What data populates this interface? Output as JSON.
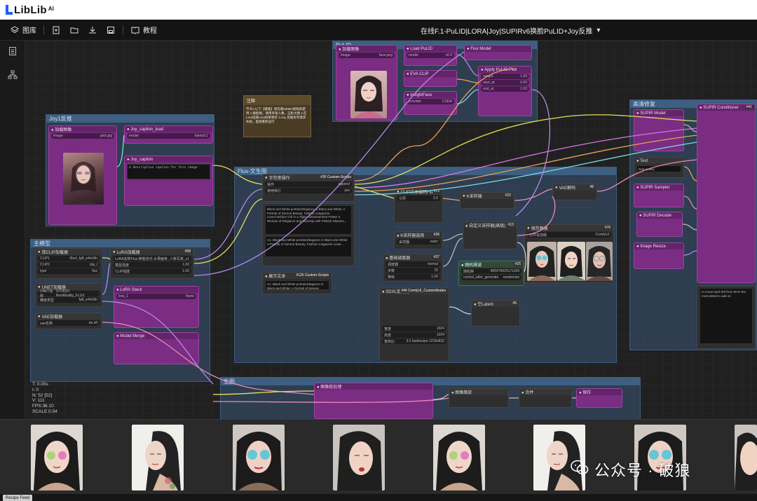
{
  "brand": {
    "name": "LibLib",
    "suffix": "AI"
  },
  "toolbar": {
    "library_label": "图库",
    "tutorial_label": "教程",
    "workflow_title": "在线F.1-PuLID|LORA|Joy|SUPIRv6换脸PuLID+Joy反推"
  },
  "groups": {
    "joy": "Joy1反推",
    "main_model": "主模型",
    "flux": "Flux-文生图",
    "enlarge": "高清修复",
    "bottom": "生图"
  },
  "nodes": {
    "note_title": "注释",
    "note_text": "节点1:以下【模版】请先看DEMO视频再使用 1.换脸图，请用单张人像，正脸大图 2.在Lora选择Lora效果更好 3.Joy 反推有时请求失败，直接重新运行",
    "caption_text": "A descriptive caption for this image",
    "prompt_node": "字符串操作",
    "custom_scripts": "#35 Custom-Scripts",
    "custom_scripts_2": "#125 Custom-Scripts",
    "prompt_text": "Black and White portrait,Elegance in Black and White: A Portrait of Serene Beauty. Fashion magazine cover,Fashion Girl in a Tiger-Advertisement Poster a Woman of Elegance and Intensity with Pinkish Glasses...",
    "prompt_text_2": "A1. Black and White portrait,Elegance in Black and White: A Portrait of Serene Beauty. Fashion magazine cover...",
    "clip_encoder": "CLIP文本编码Flux",
    "lora_loader": "LoRA加载器",
    "clip_loader": "双CLIP加载器",
    "unet_loader": "UNET加载器",
    "vae_loader": "VAE加载器",
    "ksampler": "K采样器",
    "vae_decode": "VAE解码",
    "save_image": "保存图像",
    "custom_sampler": "#44 ComfyUI_CustomNodes",
    "sampler_name": "采样器选择",
    "seed_label": "随机种",
    "seed_value": "985479625171169",
    "guidance_label": "引导",
    "guidance_value": "3.5",
    "lora_name": "Flux.换脸流光.水果面条_人像写真_v1",
    "lora_strength": "1.00",
    "clip_name1": "t5xxl_fp8_e4m3fn",
    "clip_name2": "clip_l",
    "clip_type": "flux",
    "unet_name": "STOIQO NewReality_FLUX",
    "unet_dtype": "fp8_e4m3fn",
    "vae_name": "ae.sft",
    "width_val": "1024",
    "height_val": "1024",
    "aspect_val": "3:2 landscape 1216x832",
    "steps_val": "25",
    "denoise_val": "1.00",
    "scheduler_val": "normal",
    "sampler_val": "euler",
    "output_text": "to move back left from 9mm the most detail to add on"
  },
  "stats": {
    "t": "T: 0.00s",
    "i": "I: 0",
    "n": "N: 52 [52]",
    "v": "V: 111",
    "fps": "FPS:36.10",
    "scale": "SCALE:0.54"
  },
  "queue": {
    "footer_button": "Recipe Feed"
  },
  "watermark": {
    "text": "公众号 · 破狼"
  },
  "colors": {
    "group_blue": "#3a5678",
    "node_purple": "#7a2d82",
    "accent_blue": "#1f5cff"
  }
}
